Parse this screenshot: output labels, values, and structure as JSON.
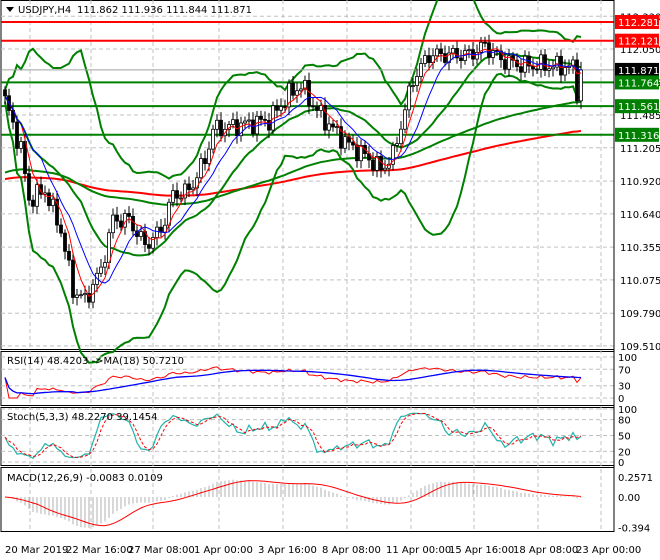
{
  "chart_data": {
    "type": "candlestick",
    "title": "USDJPY,H4",
    "ohlc_header": "111.862 111.936 111.844 111.871",
    "ylim": [
      109.45,
      112.36
    ],
    "y_ticks": [
      "112.330",
      "112.050",
      "111.765",
      "111.485",
      "111.205",
      "110.920",
      "110.640",
      "110.355",
      "110.075",
      "109.790",
      "109.510"
    ],
    "x_tick_labels": [
      "20 Mar 2019",
      "22 Mar 16:00",
      "27 Mar 08:00",
      "1 Apr 00:00",
      "3 Apr 16:00",
      "8 Apr 08:00",
      "11 Apr 00:00",
      "15 Apr 16:00",
      "18 Apr 08:00",
      "23 Apr 00:00"
    ],
    "bars": 145,
    "close_path": [
      [
        0,
        111.61
      ],
      [
        4,
        111.19
      ],
      [
        6,
        110.76
      ],
      [
        10,
        110.84
      ],
      [
        14,
        110.5
      ],
      [
        17,
        109.99
      ],
      [
        20,
        109.9
      ],
      [
        24,
        110.16
      ],
      [
        27,
        110.59
      ],
      [
        31,
        110.59
      ],
      [
        35,
        110.37
      ],
      [
        39,
        110.5
      ],
      [
        42,
        110.8
      ],
      [
        46,
        110.84
      ],
      [
        50,
        111.1
      ],
      [
        52,
        111.36
      ],
      [
        59,
        111.4
      ],
      [
        66,
        111.44
      ],
      [
        71,
        111.66
      ],
      [
        74,
        111.74
      ],
      [
        77,
        111.57
      ],
      [
        81,
        111.4
      ],
      [
        86,
        111.23
      ],
      [
        90,
        111.14
      ],
      [
        94,
        111.02
      ],
      [
        97,
        111.14
      ],
      [
        100,
        111.53
      ],
      [
        102,
        111.79
      ],
      [
        106,
        112.0
      ],
      [
        111,
        112.0
      ],
      [
        116,
        112.0
      ],
      [
        120,
        112.08
      ],
      [
        124,
        111.96
      ],
      [
        129,
        111.91
      ],
      [
        134,
        111.91
      ],
      [
        139,
        111.9
      ],
      [
        142,
        111.89
      ],
      [
        143,
        111.7
      ],
      [
        144,
        111.871
      ]
    ],
    "levels": [
      {
        "value": "112.281",
        "color": "#ff0000"
      },
      {
        "value": "112.121",
        "color": "#ff0000"
      },
      {
        "value": "111.871",
        "color": "#000000",
        "current": true
      },
      {
        "value": "111.764",
        "color": "#008000"
      },
      {
        "value": "111.561",
        "color": "#008000"
      },
      {
        "value": "111.316",
        "color": "#008000"
      }
    ],
    "indicators": {
      "rsi": {
        "label": "RSI(14) 48.4203  ->MA(18) 50.7210",
        "ticks": [
          "100",
          "70",
          "30",
          "0"
        ]
      },
      "stoch": {
        "label": "Stoch(5,3,3) 48.2270 39.1454",
        "ticks": [
          "100",
          "80",
          "50",
          "20",
          "0"
        ]
      },
      "macd": {
        "label": "MACD(12,26,9) -0.0083 0.0109",
        "ticks": [
          "0.2571",
          "0.00",
          "-0.394"
        ]
      }
    },
    "colors": {
      "bull": "#ffffff",
      "bear": "#000000",
      "band": "#008000",
      "ma_fast": "#ff0000",
      "ma_slow": "#0000ff"
    }
  }
}
